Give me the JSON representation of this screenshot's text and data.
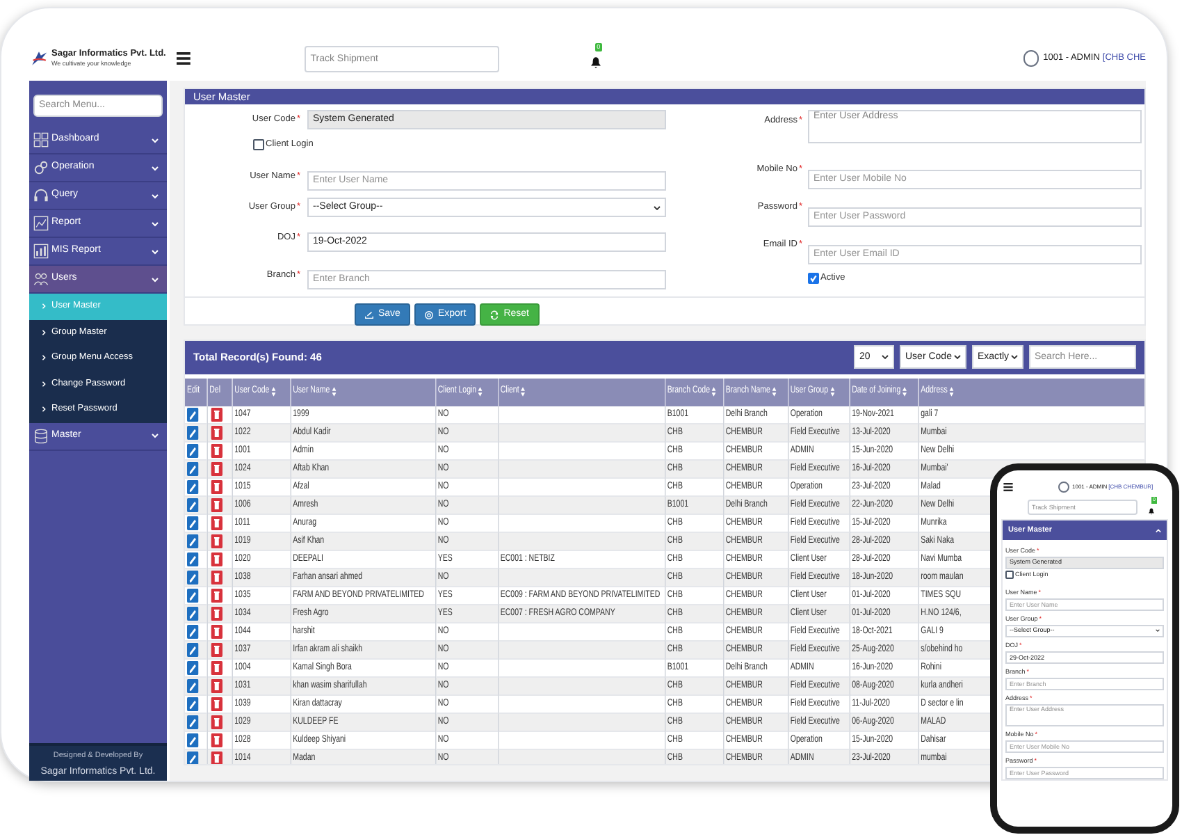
{
  "header": {
    "logo_name": "Sagar Informatics Pvt. Ltd.",
    "logo_tagline": "We cultivate your knowledge",
    "track_placeholder": "Track Shipment",
    "notification_count": "0",
    "user": "1001 - ADMIN",
    "branch": "[CHB CHE"
  },
  "sidebar": {
    "search_placeholder": "Search Menu...",
    "items": [
      {
        "label": "Dashboard",
        "expanded": false
      },
      {
        "label": "Operation",
        "expanded": false
      },
      {
        "label": "Query",
        "expanded": false
      },
      {
        "label": "Report",
        "expanded": false
      },
      {
        "label": "MIS Report",
        "expanded": false
      },
      {
        "label": "Users",
        "expanded": true,
        "children": [
          {
            "label": "User Master",
            "selected": true
          },
          {
            "label": "Group Master",
            "selected": false
          },
          {
            "label": "Group Menu Access",
            "selected": false
          },
          {
            "label": "Change Password",
            "selected": false
          },
          {
            "label": "Reset Password",
            "selected": false
          }
        ]
      },
      {
        "label": "Master",
        "expanded": false
      }
    ],
    "footer": [
      "Designed & Developed By",
      "Sagar Informatics Pvt. Ltd."
    ]
  },
  "form": {
    "title": "User Master",
    "left_fields": [
      {
        "label": "User Code",
        "mark": "*",
        "kind": "readonly",
        "value": "System Generated"
      },
      {
        "label": "Client Login",
        "kind": "checkbox",
        "checked": false
      },
      {
        "label": "User Name",
        "mark": "*",
        "kind": "text",
        "placeholder": "Enter User Name"
      },
      {
        "label": "User Group",
        "mark": "*",
        "kind": "select",
        "value": "--Select Group--"
      },
      {
        "label": "DOJ",
        "mark": "*",
        "kind": "text",
        "value": "19-Oct-2022"
      },
      {
        "label": "Branch",
        "mark": "*",
        "kind": "text",
        "placeholder": "Enter Branch"
      }
    ],
    "right_fields": [
      {
        "label": "Address",
        "mark": "*",
        "kind": "textarea",
        "placeholder": "Enter User Address"
      },
      {
        "label": "Mobile No",
        "mark": "*",
        "kind": "text",
        "placeholder": "Enter User Mobile No"
      },
      {
        "label": "Password",
        "mark": "*",
        "kind": "text",
        "placeholder": "Enter User Password"
      },
      {
        "label": "Email ID",
        "mark": "*",
        "kind": "text",
        "placeholder": "Enter User Email ID"
      },
      {
        "label": "Active",
        "kind": "checkbox",
        "checked": true
      }
    ],
    "buttons": [
      {
        "label": "Save",
        "kind": "primary"
      },
      {
        "label": "Export",
        "kind": "primary"
      },
      {
        "label": "Reset",
        "kind": "success"
      }
    ]
  },
  "table": {
    "title": "Total Record(s) Found: 46",
    "page_size": "20",
    "search_by": "User Code",
    "match": "Exactly",
    "search_placeholder": "Search Here...",
    "columns": [
      {
        "label": "Edit",
        "kind": "edit",
        "sortable": false
      },
      {
        "label": "Del",
        "kind": "delete",
        "sortable": false
      },
      {
        "label": "User Code",
        "kind": "text",
        "sortable": true
      },
      {
        "label": "User Name",
        "kind": "text",
        "sortable": true
      },
      {
        "label": "Client Login",
        "kind": "text",
        "sortable": true
      },
      {
        "label": "Client",
        "kind": "text",
        "sortable": true
      },
      {
        "label": "Branch Code",
        "kind": "text",
        "sortable": true
      },
      {
        "label": "Branch Name",
        "kind": "text",
        "sortable": true
      },
      {
        "label": "User Group",
        "kind": "text",
        "sortable": true
      },
      {
        "label": "Date of Joining",
        "kind": "text",
        "sortable": true
      },
      {
        "label": "Address",
        "kind": "text",
        "sortable": true
      }
    ],
    "rows": [
      [
        "",
        "",
        "1047",
        "1999",
        "NO",
        "",
        "B1001",
        "Delhi Branch",
        "Operation",
        "19-Nov-2021",
        "gali 7"
      ],
      [
        "",
        "",
        "1022",
        "Abdul Kadir",
        "NO",
        "",
        "CHB",
        "CHEMBUR",
        "Field Executive",
        "13-Jul-2020",
        "Mumbai"
      ],
      [
        "",
        "",
        "1001",
        "Admin",
        "NO",
        "",
        "CHB",
        "CHEMBUR",
        "ADMIN",
        "15-Jun-2020",
        "New Delhi"
      ],
      [
        "",
        "",
        "1024",
        "Aftab Khan",
        "NO",
        "",
        "CHB",
        "CHEMBUR",
        "Field Executive",
        "16-Jul-2020",
        "Mumbai'"
      ],
      [
        "",
        "",
        "1015",
        "Afzal",
        "NO",
        "",
        "CHB",
        "CHEMBUR",
        "Operation",
        "23-Jul-2020",
        "Malad"
      ],
      [
        "",
        "",
        "1006",
        "Amresh",
        "NO",
        "",
        "B1001",
        "Delhi Branch",
        "Field Executive",
        "22-Jun-2020",
        "New Delhi"
      ],
      [
        "",
        "",
        "1011",
        "Anurag",
        "NO",
        "",
        "CHB",
        "CHEMBUR",
        "Field Executive",
        "15-Jul-2020",
        "Munrika"
      ],
      [
        "",
        "",
        "1019",
        "Asif Khan",
        "NO",
        "",
        "CHB",
        "CHEMBUR",
        "Field Executive",
        "28-Jul-2020",
        "Saki Naka"
      ],
      [
        "",
        "",
        "1020",
        "DEEPALI",
        "YES",
        "EC001 : NETBIZ",
        "CHB",
        "CHEMBUR",
        "Client User",
        "28-Jul-2020",
        "Navi Mumba"
      ],
      [
        "",
        "",
        "1038",
        "Farhan ansari ahmed",
        "NO",
        "",
        "CHB",
        "CHEMBUR",
        "Field Executive",
        "18-Jun-2020",
        "room maulan"
      ],
      [
        "",
        "",
        "1035",
        "FARM AND BEYOND PRIVATELIMITED",
        "YES",
        "EC009 : FARM AND BEYOND PRIVATELIMITED",
        "CHB",
        "CHEMBUR",
        "Client User",
        "01-Jul-2020",
        "TIMES SQU"
      ],
      [
        "",
        "",
        "1034",
        "Fresh Agro",
        "YES",
        "EC007 : FRESH AGRO COMPANY",
        "CHB",
        "CHEMBUR",
        "Client User",
        "01-Jul-2020",
        "H.NO 124/6,"
      ],
      [
        "",
        "",
        "1044",
        "harshit",
        "NO",
        "",
        "CHB",
        "CHEMBUR",
        "Field Executive",
        "18-Oct-2021",
        "GALI 9"
      ],
      [
        "",
        "",
        "1037",
        "Irfan akram ali shaikh",
        "NO",
        "",
        "CHB",
        "CHEMBUR",
        "Field Executive",
        "25-Aug-2020",
        "s/obehind ho"
      ],
      [
        "",
        "",
        "1004",
        "Kamal Singh Bora",
        "NO",
        "",
        "B1001",
        "Delhi Branch",
        "ADMIN",
        "16-Jun-2020",
        "Rohini"
      ],
      [
        "",
        "",
        "1031",
        "khan wasim sharifullah",
        "NO",
        "",
        "CHB",
        "CHEMBUR",
        "Field Executive",
        "08-Aug-2020",
        "kurla andheri"
      ],
      [
        "",
        "",
        "1039",
        "Kiran dattacray",
        "NO",
        "",
        "CHB",
        "CHEMBUR",
        "Field Executive",
        "11-Jul-2020",
        "D sector e lin"
      ],
      [
        "",
        "",
        "1029",
        "KULDEEP FE",
        "NO",
        "",
        "CHB",
        "CHEMBUR",
        "Field Executive",
        "06-Aug-2020",
        "MALAD"
      ],
      [
        "",
        "",
        "1028",
        "Kuldeep Shiyani",
        "NO",
        "",
        "CHB",
        "CHEMBUR",
        "Operation",
        "15-Jun-2020",
        "Dahisar"
      ],
      [
        "",
        "",
        "1014",
        "Madan",
        "NO",
        "",
        "CHB",
        "CHEMBUR",
        "ADMIN",
        "23-Jul-2020",
        "mumbai"
      ]
    ]
  },
  "phone": {
    "user": "1001 - ADMIN",
    "branch": "[CHB CHEMBUR]",
    "track_placeholder": "Track Shipment",
    "notification_count": "0",
    "form_title": "User Master",
    "fields": [
      {
        "label": "User Code",
        "mark": "*",
        "kind": "readonly",
        "value": "System Generated"
      },
      {
        "label": "Client Login",
        "kind": "checkbox",
        "checked": false
      },
      {
        "label": "User Name",
        "mark": "*",
        "kind": "text",
        "placeholder": "Enter User Name"
      },
      {
        "label": "User Group",
        "mark": "*",
        "kind": "select",
        "value": "--Select Group--"
      },
      {
        "label": "DOJ",
        "mark": "*",
        "kind": "text",
        "value": "29-Oct-2022"
      },
      {
        "label": "Branch",
        "mark": "*",
        "kind": "text",
        "placeholder": "Enter Branch"
      },
      {
        "label": "Address",
        "mark": "*",
        "kind": "textarea",
        "placeholder": "Enter User Address"
      },
      {
        "label": "Mobile No",
        "mark": "*",
        "kind": "text",
        "placeholder": "Enter User Mobile No"
      },
      {
        "label": "Password",
        "mark": "*",
        "kind": "text",
        "placeholder": "Enter User Password"
      }
    ]
  }
}
